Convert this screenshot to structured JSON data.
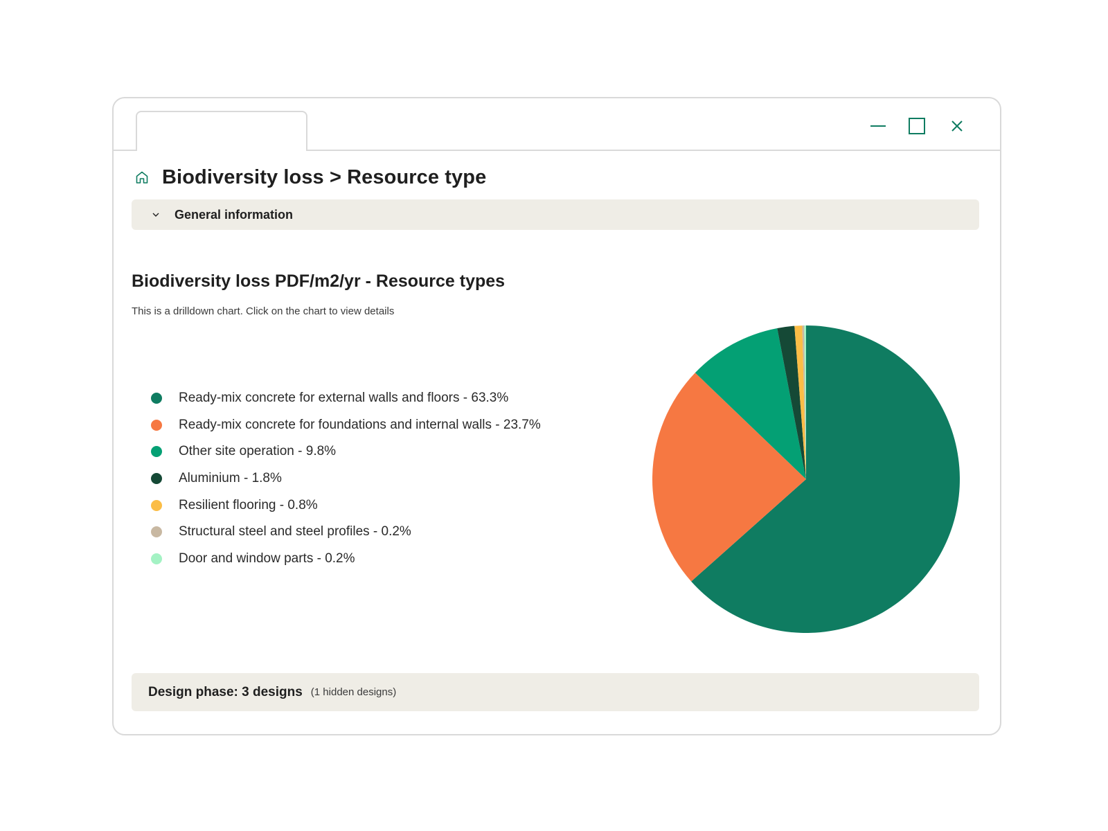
{
  "window": {
    "tab_label": "",
    "controls": {
      "minimize_icon": "minimize-icon",
      "maximize_icon": "maximize-icon",
      "close_icon": "close-icon"
    }
  },
  "header": {
    "home_icon": "home-icon",
    "title": "Biodiversity loss > Resource type"
  },
  "accordion": {
    "icon": "chevron-down-icon",
    "label": "General information"
  },
  "chart": {
    "title": "Biodiversity loss PDF/m2/yr - Resource types",
    "subtitle": "This is a drilldown chart. Click on the chart to view details"
  },
  "chart_data": {
    "type": "pie",
    "title": "Biodiversity loss PDF/m2/yr - Resource types",
    "legend_position": "left",
    "slices": [
      {
        "label": "Ready-mix concrete for external walls and floors",
        "value": 63.3,
        "legend_text": "Ready-mix concrete for external walls and floors - 63.3%",
        "color": "#0f7c61"
      },
      {
        "label": "Ready-mix concrete for foundations and internal walls",
        "value": 23.7,
        "legend_text": "Ready-mix concrete for foundations and internal walls - 23.7%",
        "color": "#f67842"
      },
      {
        "label": "Other site operation",
        "value": 9.8,
        "legend_text": "Other site operation - 9.8%",
        "color": "#04a074"
      },
      {
        "label": "Aluminium",
        "value": 1.8,
        "legend_text": "Aluminium - 1.8%",
        "color": "#154936"
      },
      {
        "label": "Resilient flooring",
        "value": 0.8,
        "legend_text": "Resilient flooring - 0.8%",
        "color": "#fbbd46"
      },
      {
        "label": "Structural steel and steel profiles",
        "value": 0.2,
        "legend_text": "Structural steel and steel profiles - 0.2%",
        "color": "#c8b8a2"
      },
      {
        "label": "Door and window parts",
        "value": 0.2,
        "legend_text": "Door and window parts - 0.2%",
        "color": "#a4f2c4"
      }
    ]
  },
  "footer": {
    "main": "Design phase: 3 designs",
    "note": "(1 hidden designs)"
  },
  "colors": {
    "accent": "#0f7c61",
    "panel_bg": "#efede6",
    "border": "#d9d9d9"
  }
}
